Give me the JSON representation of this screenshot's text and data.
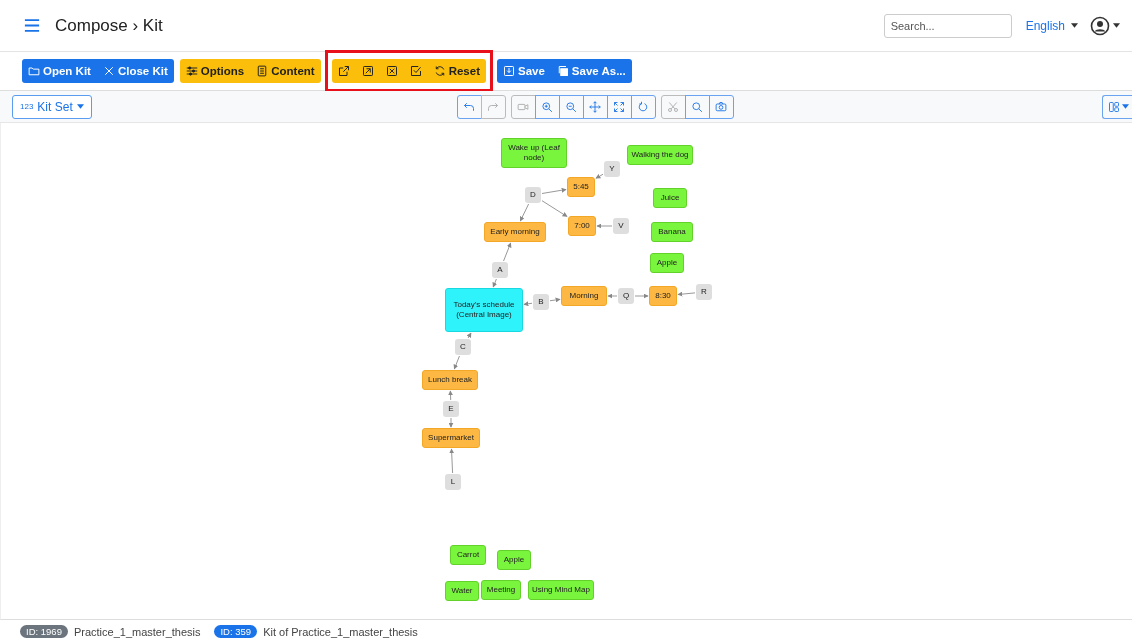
{
  "header": {
    "title": "Compose › Kit",
    "search": {
      "placeholder": "Search..."
    },
    "language": "English"
  },
  "toolbar": {
    "groups": [
      {
        "kind": "primary",
        "highlighted": false,
        "buttons": [
          {
            "label": "Open Kit"
          },
          {
            "label": "Close Kit"
          }
        ]
      },
      {
        "kind": "warning",
        "highlighted": false,
        "buttons": [
          {
            "label": "Options"
          },
          {
            "label": "Content"
          }
        ]
      },
      {
        "kind": "warning",
        "highlighted": true,
        "buttons": [
          {
            "kind": "icon"
          },
          {
            "kind": "icon"
          },
          {
            "kind": "icon"
          },
          {
            "kind": "icon"
          },
          {
            "kind": "labeled",
            "label": "Reset"
          }
        ]
      },
      {
        "kind": "primary",
        "highlighted": false,
        "buttons": [
          {
            "label": "Save"
          },
          {
            "label": "Save As..."
          }
        ]
      }
    ]
  },
  "kit_set": {
    "prefix": "123",
    "label": "Kit Set"
  },
  "view_tools": [
    [
      {
        "disabled": false
      },
      {
        "disabled": true
      }
    ],
    [
      {
        "disabled": true
      },
      {
        "disabled": false
      },
      {
        "disabled": false
      },
      {
        "disabled": false
      },
      {
        "disabled": false
      },
      {
        "disabled": false
      }
    ],
    [
      {
        "disabled": true
      },
      {
        "disabled": false
      },
      {
        "disabled": false
      }
    ]
  ],
  "canvas": {
    "nodes": [
      {
        "label": "Wake up (Leaf node)",
        "kind": "leaf"
      },
      {
        "label": "Walking the dog",
        "kind": "leaf"
      },
      {
        "label": "5:45",
        "kind": "concept"
      },
      {
        "label": "Y",
        "kind": "link"
      },
      {
        "label": "D",
        "kind": "link"
      },
      {
        "label": "Juice",
        "kind": "leaf"
      },
      {
        "label": "Early morning",
        "kind": "concept"
      },
      {
        "label": "7:00",
        "kind": "concept"
      },
      {
        "label": "V",
        "kind": "link"
      },
      {
        "label": "Banana",
        "kind": "leaf"
      },
      {
        "label": "Apple",
        "kind": "leaf"
      },
      {
        "label": "A",
        "kind": "link"
      },
      {
        "label": "Today's schedule (Central Image)",
        "kind": "central"
      },
      {
        "label": "B",
        "kind": "link"
      },
      {
        "label": "Morning",
        "kind": "concept"
      },
      {
        "label": "Q",
        "kind": "link"
      },
      {
        "label": "8:30",
        "kind": "concept"
      },
      {
        "label": "R",
        "kind": "link"
      },
      {
        "label": "C",
        "kind": "link"
      },
      {
        "label": "Lunch break",
        "kind": "concept"
      },
      {
        "label": "E",
        "kind": "link"
      },
      {
        "label": "Supermarket",
        "kind": "concept"
      },
      {
        "label": "L",
        "kind": "link"
      },
      {
        "label": "Carrot",
        "kind": "leaf"
      },
      {
        "label": "Apple",
        "kind": "leaf"
      },
      {
        "label": "Water",
        "kind": "leaf"
      },
      {
        "label": "Meeting",
        "kind": "leaf"
      },
      {
        "label": "Using Mind Map",
        "kind": "leaf"
      }
    ]
  },
  "footer": [
    {
      "id": "ID: 1969",
      "name": "Practice_1_master_thesis",
      "kind": "secondary"
    },
    {
      "id": "ID: 359",
      "name": "Kit of Practice_1_master_thesis",
      "kind": "primary"
    }
  ]
}
